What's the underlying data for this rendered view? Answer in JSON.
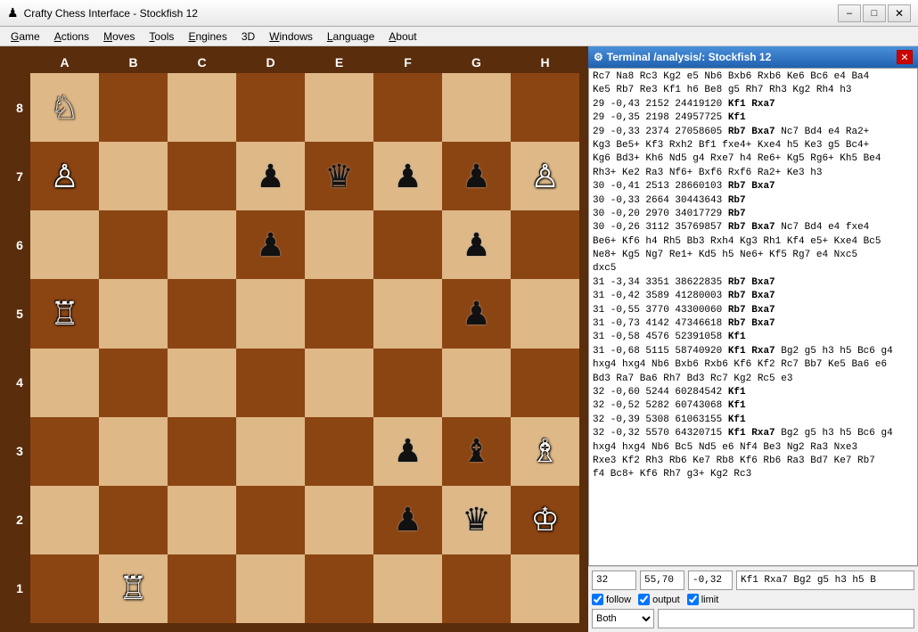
{
  "window": {
    "title": "Crafty Chess Interface - Stockfish 12",
    "icon": "♟"
  },
  "titlebar": {
    "minimize": "–",
    "maximize": "□",
    "close": "✕"
  },
  "menu": {
    "items": [
      {
        "label": "Game",
        "underline_index": 0
      },
      {
        "label": "Actions",
        "underline_index": 0
      },
      {
        "label": "Moves",
        "underline_index": 0
      },
      {
        "label": "Tools",
        "underline_index": 0
      },
      {
        "label": "Engines",
        "underline_index": 0
      },
      {
        "label": "3D",
        "underline_index": 0
      },
      {
        "label": "Windows",
        "underline_index": 0
      },
      {
        "label": "Language",
        "underline_index": 0
      },
      {
        "label": "About",
        "underline_index": 0
      }
    ]
  },
  "board": {
    "col_labels": [
      "A",
      "B",
      "C",
      "D",
      "E",
      "F",
      "G",
      "H"
    ],
    "row_labels": [
      "8",
      "7",
      "6",
      "5",
      "4",
      "3",
      "2",
      "1"
    ],
    "pieces": {
      "a8": {
        "type": "knight",
        "color": "white",
        "symbol": "♞"
      },
      "a7": {
        "type": "pawn",
        "color": "white",
        "symbol": "♟"
      },
      "a5": {
        "type": "rook",
        "color": "white",
        "symbol": "♜"
      },
      "b1": {
        "type": "rook",
        "color": "white",
        "symbol": "♜"
      },
      "d6": {
        "type": "pawn",
        "color": "black",
        "symbol": "♟"
      },
      "d7": {
        "type": "pawn",
        "color": "black",
        "symbol": "♟"
      },
      "e7": {
        "type": "queen",
        "color": "black",
        "symbol": "♛"
      },
      "f7": {
        "type": "pawn",
        "color": "black",
        "symbol": "♟"
      },
      "g6": {
        "type": "pawn",
        "color": "black",
        "symbol": "♟"
      },
      "g7": {
        "type": "pawn",
        "color": "black",
        "symbol": "♟"
      },
      "h7": {
        "type": "pawn",
        "color": "white",
        "symbol": "♟"
      },
      "f3": {
        "type": "pawn",
        "color": "black",
        "symbol": "♟"
      },
      "g3": {
        "type": "bishop",
        "color": "black",
        "symbol": "♝"
      },
      "h3": {
        "type": "bishop",
        "color": "white",
        "symbol": "♝"
      },
      "f2": {
        "type": "pawn",
        "color": "black",
        "symbol": "♟"
      },
      "g2": {
        "type": "queen",
        "color": "black",
        "symbol": "♛"
      },
      "h2": {
        "type": "king",
        "color": "white",
        "symbol": "♔"
      },
      "g5": {
        "type": "pawn",
        "color": "black",
        "symbol": "♟"
      }
    }
  },
  "terminal": {
    "title": "Terminal /analysis/: Stockfish 12",
    "icon": "⚙",
    "content_lines": [
      "Rc7 Na8 Rc3 Kg2 e5 Nb6 Bxb6 Rxb6 Ke6 Bc6 e4 Ba4",
      "Ke5 Rb7 Re3 Kf1 h6 Be8 g5 Rh7 Rh3 Kg2 Rh4 h3",
      "29  -0,43  2152  24419120  Kf1  Rxa7",
      "29  -0,35  2198  24957725  Kf1",
      "29  -0,33  2374  27058605  Rb7  Bxa7 Nc7 Bd4 e4 Ra2+",
      "Kg3 Be5+ Kf3 Rxh2 Bf1 fxe4+ Kxe4 h5 Ke3 g5 Bc4+",
      "Kg6 Bd3+ Kh6 Nd5 g4 Rxe7 h4 Re6+ Kg5 Rg6+ Kh5 Be4",
      "Rh3+ Ke2 Ra3 Nf6+ Bxf6 Rxf6 Ra2+ Ke3 h3",
      "30  -0,41  2513  28660103  Rb7  Bxa7",
      "30  -0,33  2664  30443643  Rb7",
      "30  -0,20  2970  34017729  Rb7",
      "30  -0,26  3112  35769857  Rb7  Bxa7 Nc7 Bd4 e4 fxe4",
      "Be6+ Kf6 h4 Rh5 Bb3 Rxh4 Kg3 Rh1 Kf4 e5+ Kxe4 Bc5",
      "Ne8+ Kg5 Ng7 Re1+ Kd5 h5 Ne6+ Kf5 Rg7 e4 Nxc5",
      "dxc5",
      "31  -3,34  3351  38622835  Rb7  Bxa7",
      "31  -0,42  3589  41280003  Rb7  Bxa7",
      "31  -0,55  3770  43300060  Rb7  Bxa7",
      "31  -0,73  4142  47346618  Rb7  Bxa7",
      "31  -0,58  4576  52391058  Kf1",
      "31  -0,68  5115  58740920  Kf1  Rxa7 Bg2 g5 h3 h5 Bc6 g4",
      "hxg4 hxg4 Nb6 Bxb6 Rxb6 Kf6 Kf2 Rc7 Bb7 Ke5 Ba6 e6",
      "Bd3 Ra7 Ba6 Rh7 Bd3 Rc7 Kg2 Rc5 e3",
      "32  -0,60  5244  60284542  Kf1",
      "32  -0,52  5282  60743068  Kf1",
      "32  -0,39  5308  61063155  Kf1",
      "32  -0,32  5570  64320715  Kf1  Rxa7 Bg2 g5 h3 h5 Bc6 g4",
      "hxg4 hxg4 Nb6 Bc5 Nd5 e6 Nf4 Be3 Ng2 Ra3 Nxe3",
      "Rxe3 Kf2 Rh3 Rb6 Ke7 Rb8 Kf6 Rb6 Ra3 Bd7 Ke7 Rb7",
      "f4 Bc8+ Kf6 Rh7 g3+ Kg2 Rc3"
    ],
    "bottom": {
      "depth": "32",
      "time": "55,70",
      "score": "-0,32",
      "move_text": "Kf1 Rxa7 Bg2 g5 h3 h5 B",
      "follow_checked": true,
      "follow_label": "follow",
      "output_checked": true,
      "output_label": "output",
      "limit_checked": true,
      "limit_label": "limit",
      "side_select": "Both",
      "cmd_input": ""
    }
  },
  "indicators": {
    "red_dot": "active",
    "gray_dot": "inactive"
  }
}
